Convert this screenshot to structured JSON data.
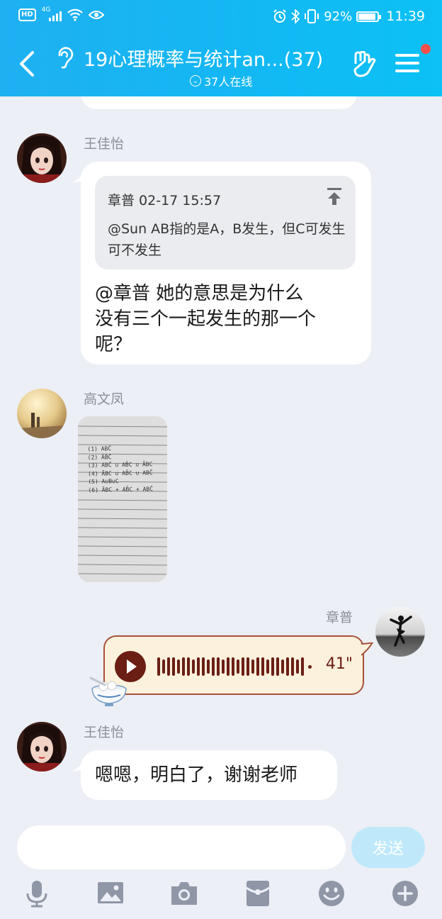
{
  "status_bar": {
    "hd": "HD",
    "network": "4G",
    "battery": "92%",
    "battery_level": 0.92,
    "time": "11:39"
  },
  "header": {
    "title": "19心理概率与统计an...(37)",
    "online": "37人在线"
  },
  "messages": [
    {
      "sender": "王佳怡",
      "quote": {
        "meta": "章普 02-17 15:57",
        "text": "@Sun  AB指的是A，B发生，但C可发生可不发生"
      },
      "lines": [
        "@章普 她的意思是为什么",
        "没有三个一起发生的那一个",
        "呢？"
      ]
    },
    {
      "sender": "高文凤",
      "image_note_lines": [
        "(1) ABC̄",
        "(2) ĀB̄C̄",
        "(3) ABC̄ ∪ AB̄C ∪ ĀBC",
        "(4) ĀBC ∪ AB̄C ∪ ABC̄",
        "(5) A∪B∪C",
        "(6) ĀBC + AB̄C + ABC̄"
      ]
    },
    {
      "sender": "章普",
      "voice_duration": "41\""
    },
    {
      "sender": "王佳怡",
      "text": "嗯嗯，明白了，谢谢老师"
    }
  ],
  "input": {
    "value": "",
    "send_label": "发送"
  },
  "toolbar_icons": [
    "microphone-icon",
    "image-icon",
    "camera-icon",
    "red-packet-icon",
    "emoji-icon",
    "plus-icon"
  ]
}
